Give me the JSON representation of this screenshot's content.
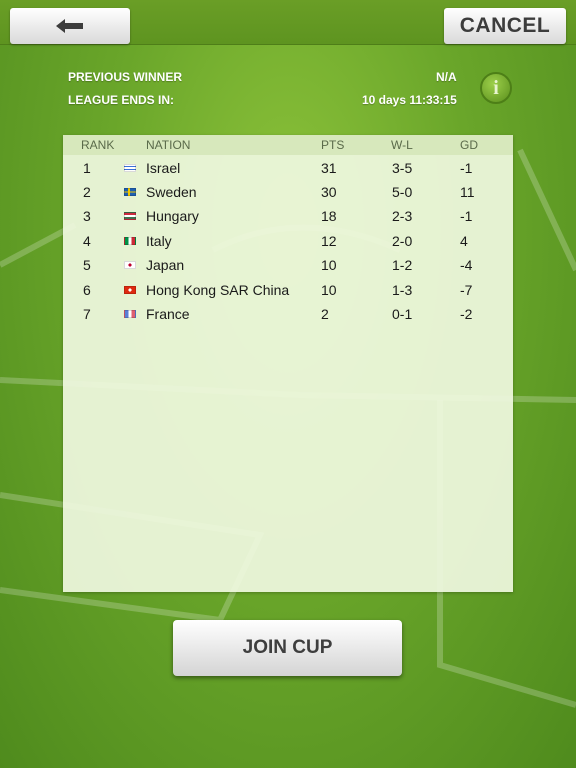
{
  "header": {
    "back_icon": "left-arrow-icon",
    "cancel_label": "CANCEL"
  },
  "info": {
    "previous_winner_label": "PREVIOUS WINNER",
    "previous_winner_value": "N/A",
    "league_ends_label": "LEAGUE ENDS IN:",
    "league_ends_value": "10 days 11:33:15",
    "info_icon": "info-icon"
  },
  "table": {
    "headers": {
      "rank": "RANK",
      "nation": "NATION",
      "pts": "PTS",
      "wl": "W-L",
      "gd": "GD"
    },
    "rows": [
      {
        "rank": "1",
        "nation": "Israel",
        "pts": "31",
        "wl": "3-5",
        "gd": "-1",
        "flag": "israel-flag-icon"
      },
      {
        "rank": "2",
        "nation": "Sweden",
        "pts": "30",
        "wl": "5-0",
        "gd": "11",
        "flag": "sweden-flag-icon"
      },
      {
        "rank": "3",
        "nation": "Hungary",
        "pts": "18",
        "wl": "2-3",
        "gd": "-1",
        "flag": "hungary-flag-icon"
      },
      {
        "rank": "4",
        "nation": "Italy",
        "pts": "12",
        "wl": "2-0",
        "gd": "4",
        "flag": "italy-flag-icon"
      },
      {
        "rank": "5",
        "nation": "Japan",
        "pts": "10",
        "wl": "1-2",
        "gd": "-4",
        "flag": "japan-flag-icon"
      },
      {
        "rank": "6",
        "nation": "Hong Kong SAR China",
        "pts": "10",
        "wl": "1-3",
        "gd": "-7",
        "flag": "hong-kong-flag-icon"
      },
      {
        "rank": "7",
        "nation": "France",
        "pts": "2",
        "wl": "0-1",
        "gd": "-2",
        "flag": "france-flag-icon"
      }
    ]
  },
  "footer": {
    "join_label": "JOIN CUP"
  }
}
